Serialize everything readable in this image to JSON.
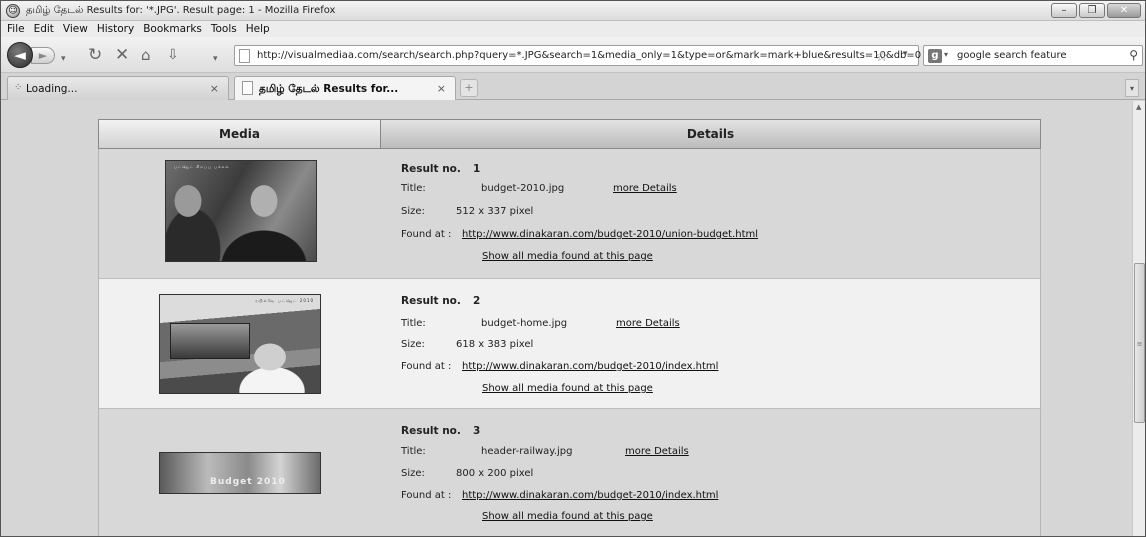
{
  "window": {
    "title": "தமிழ் தேடல் Results for: '*.JPG'. Result page: 1 - Mozilla Firefox",
    "minimize": "–",
    "maximize": "❐",
    "close": "✕"
  },
  "menu": [
    "File",
    "Edit",
    "View",
    "History",
    "Bookmarks",
    "Tools",
    "Help"
  ],
  "nav": {
    "url": "http://visualmediaa.com/search/search.php?query=*.JPG&search=1&media_only=1&type=or&mark=mark+blue&results=10&db=0",
    "search_query": "google search feature"
  },
  "tabs": [
    {
      "label": "Loading...",
      "active": false
    },
    {
      "label": "தமிழ் தேடல் Results for...",
      "active": true
    }
  ],
  "table": {
    "headers": {
      "media": "Media",
      "details": "Details"
    },
    "labels": {
      "result_no": "Result no.",
      "title": "Title:",
      "size": "Size:",
      "found_at": "Found at :",
      "more_details": "more Details",
      "show_all": "Show all media found at this page"
    },
    "results": [
      {
        "no": "1",
        "title": "budget-2010.jpg",
        "size": "512 x 337 pixel",
        "found_at": "http://www.dinakaran.com/budget-2010/union-budget.html",
        "thumb_caption": "பட்ஜெட் சிறப்பு பக்கம்"
      },
      {
        "no": "2",
        "title": "budget-home.jpg",
        "size": "618 x 383 pixel",
        "found_at": "http://www.dinakaran.com/budget-2010/index.html",
        "thumb_caption": "ரயில்வே பட்ஜெட் 2010"
      },
      {
        "no": "3",
        "title": "header-railway.jpg",
        "size": "800 x 200 pixel",
        "found_at": "http://www.dinakaran.com/budget-2010/index.html",
        "thumb_caption": "Budget 2010"
      }
    ]
  }
}
